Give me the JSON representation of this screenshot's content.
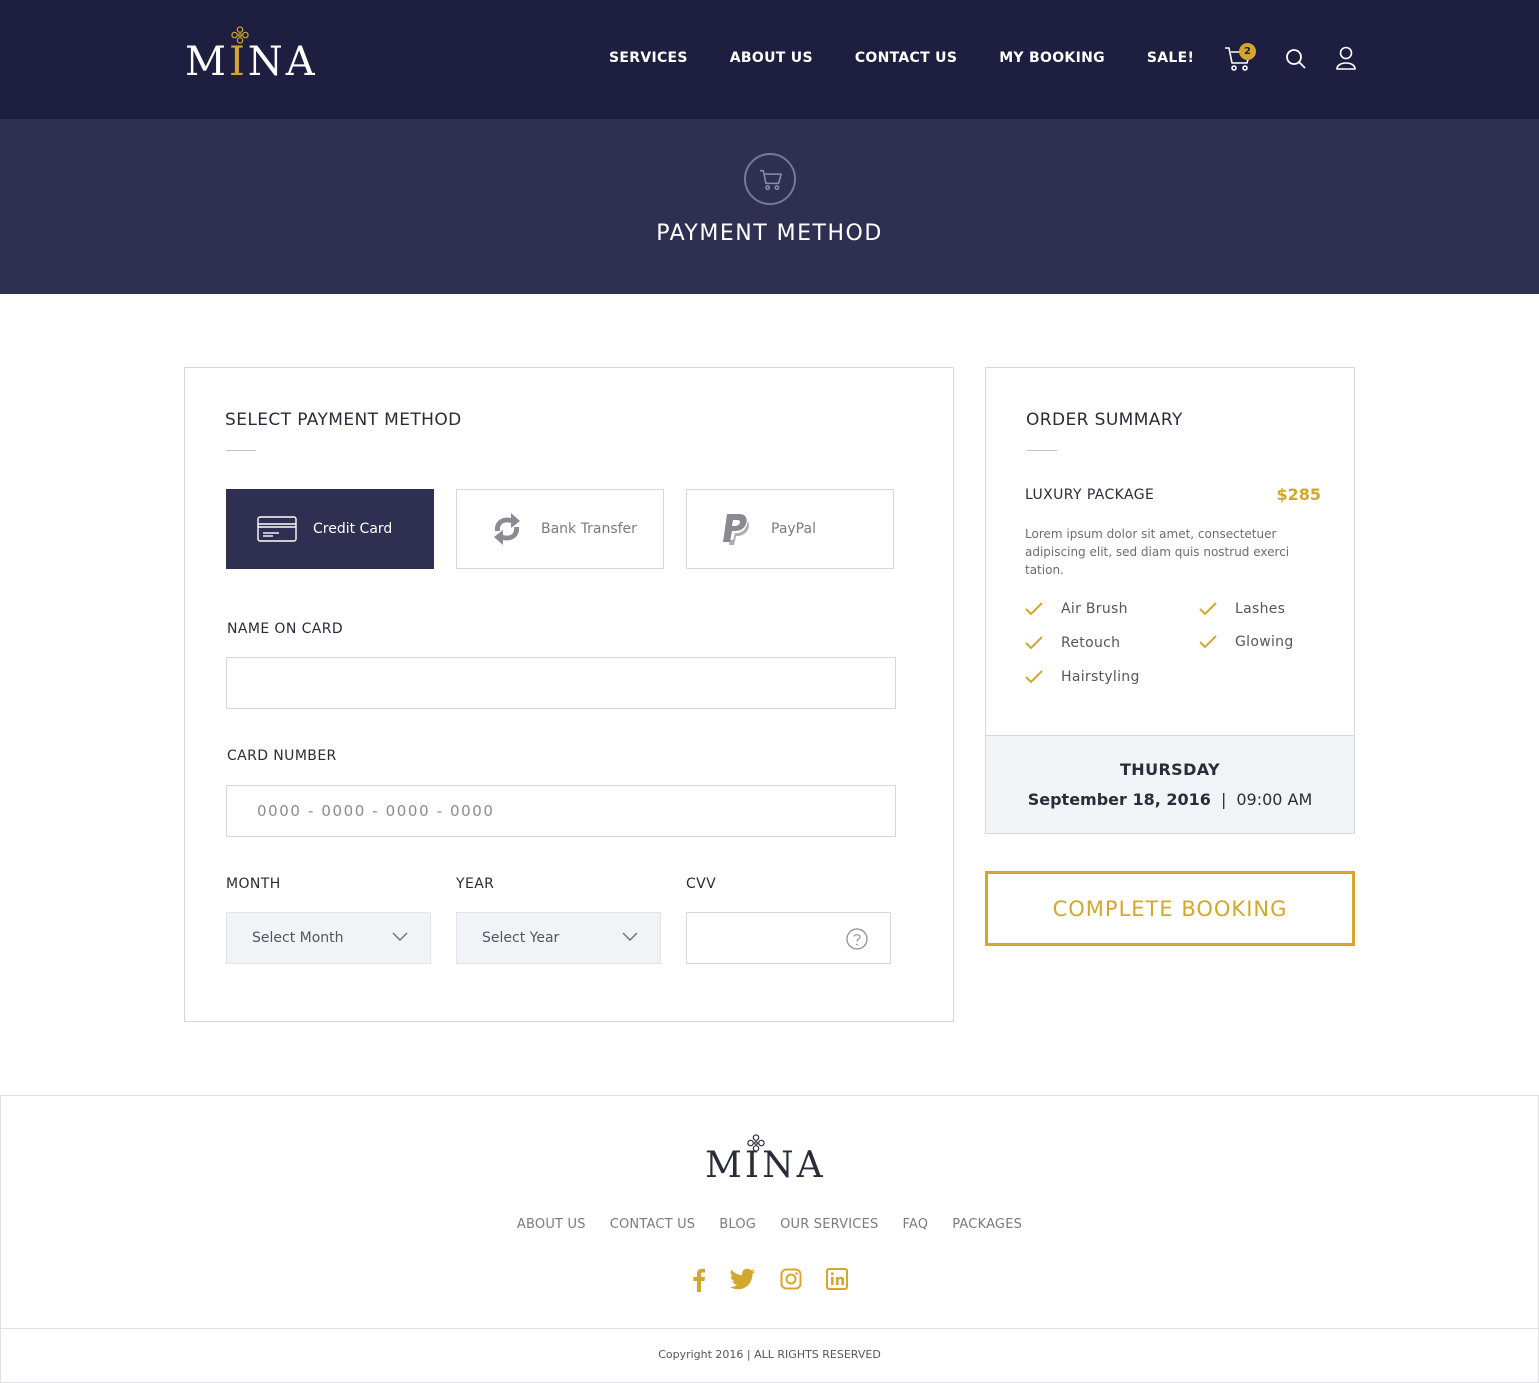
{
  "header": {
    "logo_text_left": "M",
    "logo_text_i": "I",
    "logo_text_right": "NA",
    "nav": [
      "SERVICES",
      "ABOUT US",
      "CONTACT US",
      "MY BOOKING",
      "SALE!"
    ],
    "cart_count": "2",
    "icons": [
      "cart-icon",
      "search-icon",
      "user-icon"
    ]
  },
  "banner": {
    "icon": "cart-icon",
    "title": "PAYMENT METHOD"
  },
  "payment": {
    "title": "SELECT PAYMENT METHOD",
    "methods": [
      {
        "label": "Credit Card",
        "icon": "credit-card-icon",
        "selected": true
      },
      {
        "label": "Bank Transfer",
        "icon": "bank-transfer-icon",
        "selected": false
      },
      {
        "label": "PayPal",
        "icon": "paypal-icon",
        "selected": false
      }
    ],
    "name_label": "NAME ON CARD",
    "name_value": "",
    "card_label": "CARD NUMBER",
    "card_placeholder": "0000 - 0000 - 0000 - 0000",
    "month_label": "MONTH",
    "month_value": "Select Month",
    "year_label": "YEAR",
    "year_value": "Select Year",
    "cvv_label": "CVV",
    "cvv_value": ""
  },
  "summary": {
    "title": "ORDER SUMMARY",
    "package_name": "LUXURY PACKAGE",
    "package_price": "$285",
    "package_desc": "Lorem ipsum dolor sit amet, consectetuer adipiscing elit, sed diam quis nostrud exerci tation.",
    "features": [
      "Air Brush",
      "Lashes",
      "Retouch",
      "Glowing",
      "Hairstyling"
    ],
    "day": "THURSDAY",
    "date": "September 18, 2016",
    "separator": "|",
    "time": "09:00 AM",
    "complete_label": "COMPLETE BOOKING"
  },
  "footer": {
    "links": [
      "ABOUT US",
      "CONTACT US",
      "BLOG",
      "OUR SERVICES",
      "FAQ",
      "PACKAGES"
    ],
    "social": [
      "facebook-icon",
      "twitter-icon",
      "instagram-icon",
      "linkedin-icon"
    ],
    "copyright": "Copyright 2016 | ALL RIGHTS RESERVED"
  },
  "colors": {
    "navy": "#1e1e40",
    "banner": "#2f2f52",
    "gold": "#d4a72c"
  }
}
